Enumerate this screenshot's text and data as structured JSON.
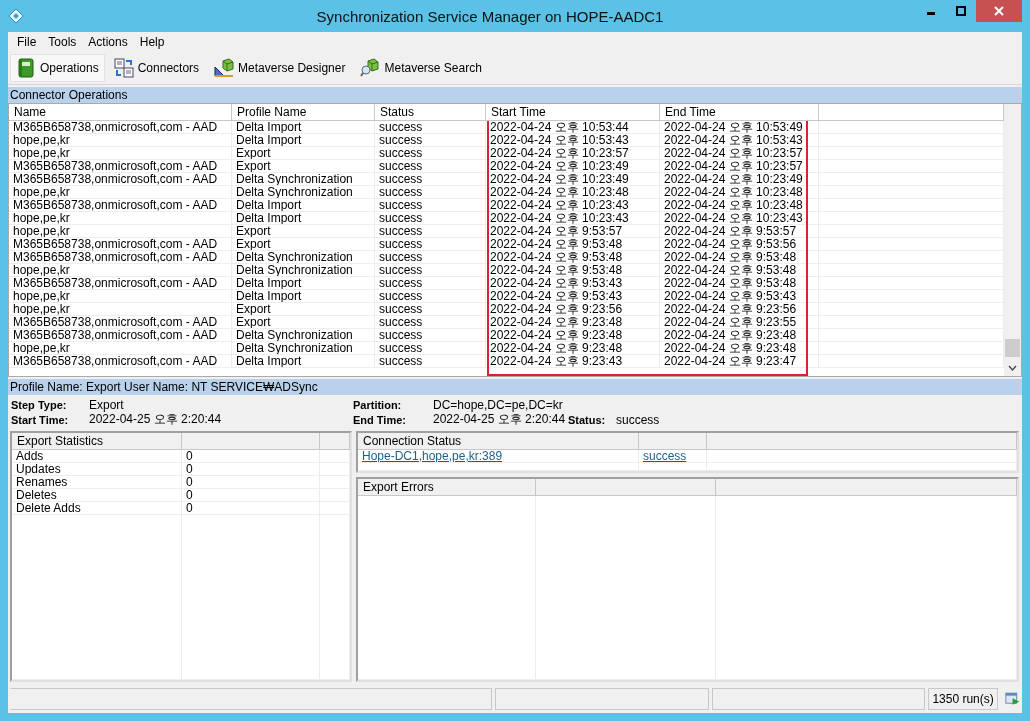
{
  "window": {
    "title": "Synchronization Service Manager on HOPE-AADC1"
  },
  "menu": [
    "File",
    "Tools",
    "Actions",
    "Help"
  ],
  "toolbar": [
    {
      "label": "Operations",
      "selected": true
    },
    {
      "label": "Connectors",
      "selected": false
    },
    {
      "label": "Metaverse Designer",
      "selected": false
    },
    {
      "label": "Metaverse Search",
      "selected": false
    }
  ],
  "operations": {
    "title": "Connector Operations",
    "columns": [
      "Name",
      "Profile Name",
      "Status",
      "Start Time",
      "End Time"
    ],
    "highlight": {
      "kind": "outline",
      "color": "#d9232e"
    },
    "rows": [
      [
        "M365B658738,onmicrosoft,com - AAD",
        "Delta Import",
        "success",
        "2022-04-24 오후 10:53:44",
        "2022-04-24 오후 10:53:49"
      ],
      [
        "hope,pe,kr",
        "Delta Import",
        "success",
        "2022-04-24 오후 10:53:43",
        "2022-04-24 오후 10:53:43"
      ],
      [
        "hope,pe,kr",
        "Export",
        "success",
        "2022-04-24 오후 10:23:57",
        "2022-04-24 오후 10:23:57"
      ],
      [
        "M365B658738,onmicrosoft,com - AAD",
        "Export",
        "success",
        "2022-04-24 오후 10:23:49",
        "2022-04-24 오후 10:23:57"
      ],
      [
        "M365B658738,onmicrosoft,com - AAD",
        "Delta Synchronization",
        "success",
        "2022-04-24 오후 10:23:49",
        "2022-04-24 오후 10:23:49"
      ],
      [
        "hope,pe,kr",
        "Delta Synchronization",
        "success",
        "2022-04-24 오후 10:23:48",
        "2022-04-24 오후 10:23:48"
      ],
      [
        "M365B658738,onmicrosoft,com - AAD",
        "Delta Import",
        "success",
        "2022-04-24 오후 10:23:43",
        "2022-04-24 오후 10:23:48"
      ],
      [
        "hope,pe,kr",
        "Delta Import",
        "success",
        "2022-04-24 오후 10:23:43",
        "2022-04-24 오후 10:23:43"
      ],
      [
        "hope,pe,kr",
        "Export",
        "success",
        "2022-04-24 오후 9:53:57",
        "2022-04-24 오후 9:53:57"
      ],
      [
        "M365B658738,onmicrosoft,com - AAD",
        "Export",
        "success",
        "2022-04-24 오후 9:53:48",
        "2022-04-24 오후 9:53:56"
      ],
      [
        "M365B658738,onmicrosoft,com - AAD",
        "Delta Synchronization",
        "success",
        "2022-04-24 오후 9:53:48",
        "2022-04-24 오후 9:53:48"
      ],
      [
        "hope,pe,kr",
        "Delta Synchronization",
        "success",
        "2022-04-24 오후 9:53:48",
        "2022-04-24 오후 9:53:48"
      ],
      [
        "M365B658738,onmicrosoft,com - AAD",
        "Delta Import",
        "success",
        "2022-04-24 오후 9:53:43",
        "2022-04-24 오후 9:53:48"
      ],
      [
        "hope,pe,kr",
        "Delta Import",
        "success",
        "2022-04-24 오후 9:53:43",
        "2022-04-24 오후 9:53:43"
      ],
      [
        "hope,pe,kr",
        "Export",
        "success",
        "2022-04-24 오후 9:23:56",
        "2022-04-24 오후 9:23:56"
      ],
      [
        "M365B658738,onmicrosoft,com - AAD",
        "Export",
        "success",
        "2022-04-24 오후 9:23:48",
        "2022-04-24 오후 9:23:55"
      ],
      [
        "M365B658738,onmicrosoft,com - AAD",
        "Delta Synchronization",
        "success",
        "2022-04-24 오후 9:23:48",
        "2022-04-24 오후 9:23:48"
      ],
      [
        "hope,pe,kr",
        "Delta Synchronization",
        "success",
        "2022-04-24 오후 9:23:48",
        "2022-04-24 오후 9:23:48"
      ],
      [
        "M365B658738,onmicrosoft,com - AAD",
        "Delta Import",
        "success",
        "2022-04-24 오후 9:23:43",
        "2022-04-24 오후 9:23:47"
      ]
    ]
  },
  "details": {
    "title": "Profile Name: Export  User Name: NT SERVICE₩ADSync",
    "fields": [
      {
        "label": "Step Type:",
        "value": "Export"
      },
      {
        "label": "Partition:",
        "value": "DC=hope,DC=pe,DC=kr"
      },
      {
        "label": "Start Time:",
        "value": "2022-04-25 오후 2:20:44"
      },
      {
        "label": "End Time:",
        "value": "2022-04-25 오후 2:20:44"
      },
      {
        "label": "Status:",
        "value": "success"
      }
    ],
    "export_statistics": {
      "title": "Export Statistics",
      "rows": [
        [
          "Adds",
          "0"
        ],
        [
          "Updates",
          "0"
        ],
        [
          "Renames",
          "0"
        ],
        [
          "Deletes",
          "0"
        ],
        [
          "Delete Adds",
          "0"
        ]
      ]
    },
    "connection_status": {
      "title": "Connection Status",
      "rows": [
        [
          "Hope-DC1,hope,pe,kr:389",
          "success"
        ]
      ]
    },
    "export_errors": {
      "title": "Export Errors"
    }
  },
  "status_bar": {
    "runs": "1350 run(s)"
  }
}
